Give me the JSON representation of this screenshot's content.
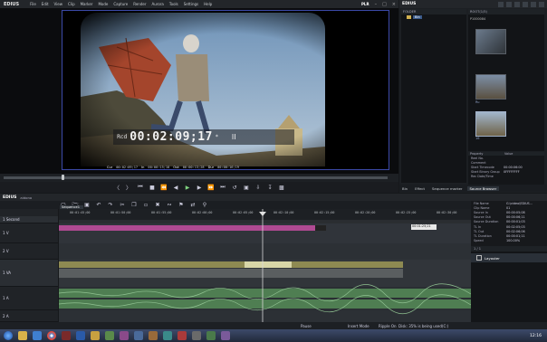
{
  "menubar": {
    "brand": "EDIUS",
    "items": [
      "File",
      "Edit",
      "View",
      "Clip",
      "Marker",
      "Mode",
      "Capture",
      "Render",
      "Aurora",
      "Tools",
      "Settings",
      "Help"
    ],
    "mode_label": "PLR"
  },
  "player": {
    "tc_label": "Rcd",
    "timecode": "00:02:09;17",
    "tc_suffix": "*",
    "pause_symbol": "II",
    "info": {
      "cur_label": "Cur",
      "cur": "00:02:09;17",
      "in_label": "In",
      "in": "00:00:15;18",
      "out_label": "Out",
      "out": "00:00:13;28",
      "dur_label": "Dur",
      "dur": "00:00:16;19"
    }
  },
  "right_panel": {
    "title": "EDIUS",
    "folder_label": "FOLDER",
    "folder_item": "Bin",
    "bin_label": "ROOT(1/5)",
    "clips": [
      "P1000084",
      "",
      "clip",
      "Ru",
      "16"
    ],
    "property_headers": [
      "Property",
      "Value"
    ],
    "properties": [
      {
        "k": "Reel No.",
        "v": ""
      },
      {
        "k": "Comment",
        "v": ""
      },
      {
        "k": "Start Timecode",
        "v": "00:00:06:00"
      },
      {
        "k": "Start Binary Group",
        "v": "0FFFFFFFF"
      },
      {
        "k": "Rec Date/Time",
        "v": ""
      }
    ],
    "tabs": [
      "Bin",
      "Effect",
      "Sequence marker",
      "Source Browser"
    ]
  },
  "editor": {
    "title": "EDIUS",
    "subtitle": "aidono",
    "sequence_tab": "Sequence1",
    "ruler_ticks": [
      "00:01:45;00",
      "00:01:50;00",
      "00:01:55;00",
      "00:02:00;00",
      "00:02:05;00",
      "00:02:10;00",
      "00:02:15;00",
      "00:02:20;00",
      "00:02:25;00",
      "00:02:30;00"
    ],
    "tracks": [
      "1 Second",
      "1 V",
      "2 V",
      "1 VA",
      "1 A",
      "2 A"
    ],
    "tooltip_tc": "00:01:25;21"
  },
  "info_panel": {
    "rows": [
      {
        "k": "File Name",
        "v": "G:\\video\\EDIUS..."
      },
      {
        "k": "Clip Name",
        "v": "01"
      },
      {
        "k": "Source In",
        "v": "00:00:05;08"
      },
      {
        "k": "Source Out",
        "v": "00:00:06;11"
      },
      {
        "k": "Source Duration",
        "v": "00:00:01;03"
      },
      {
        "k": "TL In",
        "v": "00:02:05;03"
      },
      {
        "k": "TL Out",
        "v": "00:02:06;06"
      },
      {
        "k": "TL Duration",
        "v": "00:00:01;11"
      },
      {
        "k": "Speed",
        "v": "100.00%"
      }
    ]
  },
  "layouter": {
    "header": "1 / 1",
    "item": "Layouter"
  },
  "status_bar": {
    "pause": "Pause",
    "insert_mode": "Insert Mode",
    "ripple": "Ripple On",
    "disk": "Disk: 35% is being used(C:)"
  },
  "taskbar": {
    "time": "12:16",
    "icons": [
      "start",
      "folder",
      "media",
      "chrome",
      "edius",
      "word",
      "paint",
      "app7",
      "app8",
      "app9",
      "app10",
      "app11",
      "app12",
      "app13",
      "app14",
      "app15",
      "app16"
    ]
  },
  "colors": {
    "panel": "#1c1f23",
    "accent_blue": "#3b49a8",
    "clip_video": "#8e8a52",
    "clip_magenta": "#b04a92",
    "audio_green": "#4f7e52"
  }
}
